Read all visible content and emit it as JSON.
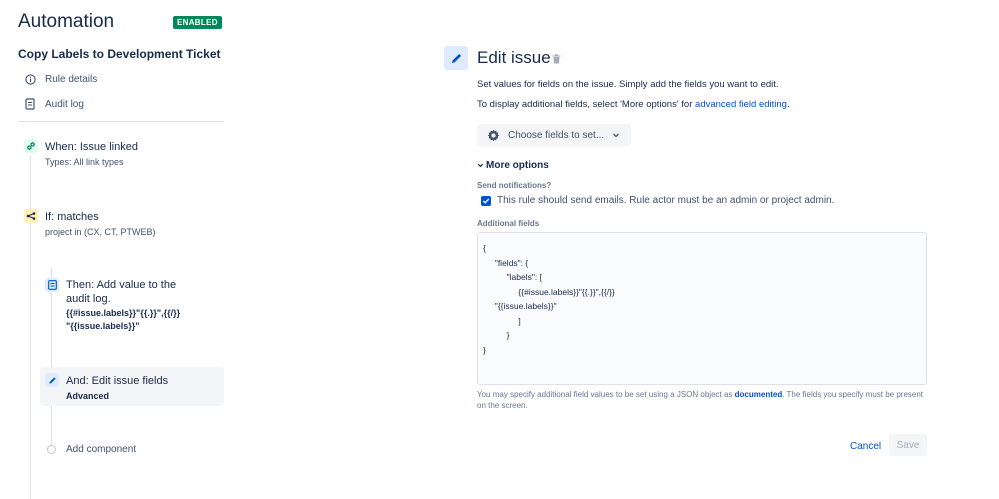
{
  "header": {
    "title": "Automation",
    "status_badge": "ENABLED",
    "status_color": "#00875a"
  },
  "rule": {
    "name": "Copy Labels to Development Ticket",
    "links": [
      {
        "label": "Rule details",
        "icon": "info-icon"
      },
      {
        "label": "Audit log",
        "icon": "document-icon"
      }
    ]
  },
  "steps": {
    "trigger": {
      "title": "When: Issue linked",
      "sub": "Types: All link types",
      "icon": "link-icon",
      "color": "#36b37e"
    },
    "condition": {
      "title": "If: matches",
      "sub": "project in (CX, CT, PTWEB)",
      "icon": "branch-icon",
      "color": "#ffc400"
    },
    "action1": {
      "title_line1": "Then: Add value to the",
      "title_line2": "audit log.",
      "code_line1": "{{#issue.labels}}\"{{.}}\",{{/}}",
      "code_line2": "\"{{issue.labels}}\"",
      "icon": "document-icon",
      "color": "#4c9aff"
    },
    "action2": {
      "title": "And: Edit issue fields",
      "sub": "Advanced",
      "icon": "pencil-icon",
      "color": "#0052cc"
    },
    "add_component": "Add component"
  },
  "editor": {
    "title": "Edit issue",
    "desc1": "Set values for fields on the issue. Simply add the fields you want to edit.",
    "desc2_prefix": "To display additional fields, select 'More options' for ",
    "desc2_link": "advanced field editing",
    "desc2_suffix": ".",
    "choose_fields": "Choose fields to set...",
    "more_options": "More options",
    "send_notifications_label": "Send notifications?",
    "send_notifications_text": "This rule should send emails. Rule actor must be an admin or project admin.",
    "send_notifications_checked": true,
    "additional_fields_label": "Additional fields",
    "additional_fields_value": "{\n     \"fields\": {\n          \"labels\": [\n               {{#issue.labels}}\"{{.}}\",{{/}}\n     \"{{issue.labels}}\"\n               ]\n          }\n}",
    "helper_prefix": "You may specify additional field values to be set using a JSON object as ",
    "helper_link": "documented",
    "helper_suffix": ". The fields you specify must be present on the screen.",
    "cancel": "Cancel",
    "save": "Save"
  }
}
